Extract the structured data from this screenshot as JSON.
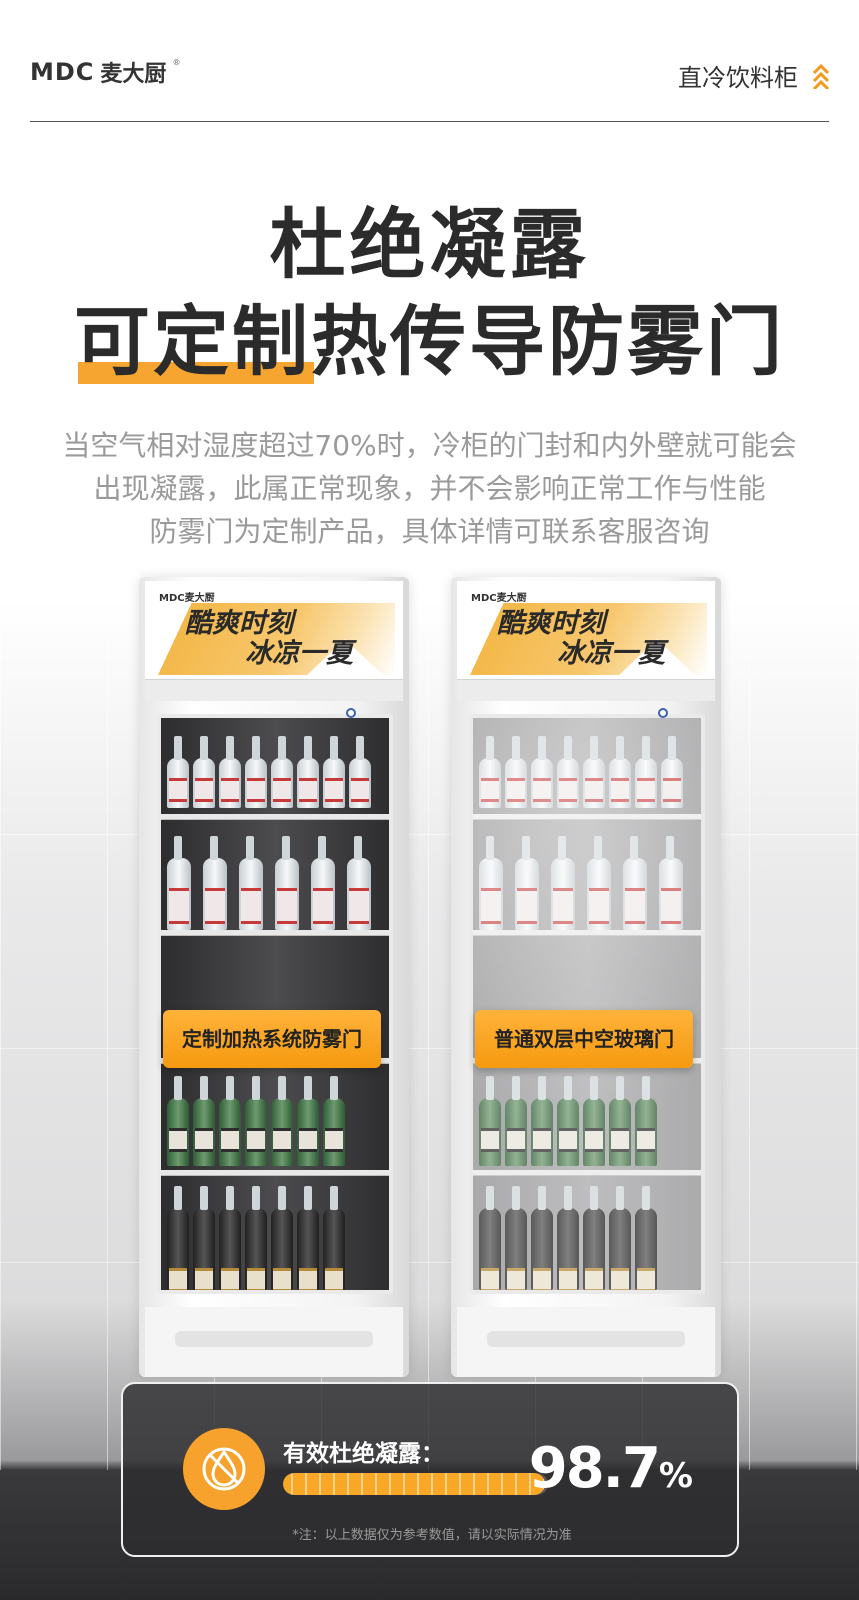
{
  "header": {
    "logo_latin": "MDC",
    "logo_cn": "麦大厨",
    "logo_reg": "®",
    "category": "直冷饮料柜"
  },
  "hero": {
    "title_line1": "杜绝凝露",
    "title_line2": "可定制热传导防雾门",
    "description_lines": [
      "当空气相对湿度超过70%时，冷柜的门封和内外壁就可能会",
      "出现凝露，此属正常现象，并不会影响正常工作与性能",
      "防雾门为定制产品，具体详情可联系客服咨询"
    ]
  },
  "fridges": [
    {
      "brand": "MDC麦大厨",
      "banner_line1": "酷爽时刻",
      "banner_line2": "冰凉一夏",
      "badge": "定制加热系统防雾门"
    },
    {
      "brand": "MDC麦大厨",
      "banner_line1": "酷爽时刻",
      "banner_line2": "冰凉一夏",
      "badge": "普通双层中空玻璃门"
    }
  ],
  "stat": {
    "label": "有效杜绝凝露：",
    "value": "98.7",
    "unit": "%",
    "progress": 0.987,
    "note": "*注：以上数据仅为参考数值，请以实际情况为准",
    "icon": "no-drop-icon"
  },
  "colors": {
    "accent": "#f6a630",
    "title": "#2b2b2b",
    "desc": "#9a9a9a"
  }
}
